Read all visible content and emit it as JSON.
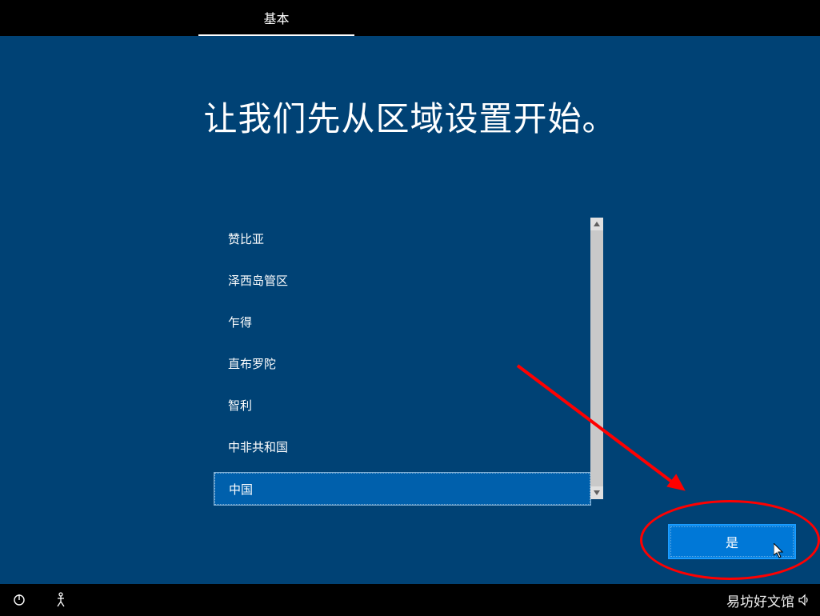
{
  "header": {
    "tab_label": "基本"
  },
  "heading": "让我们先从区域设置开始。",
  "regions": {
    "items": [
      {
        "label": "赞比亚",
        "selected": false
      },
      {
        "label": "泽西岛管区",
        "selected": false
      },
      {
        "label": "乍得",
        "selected": false
      },
      {
        "label": "直布罗陀",
        "selected": false
      },
      {
        "label": "智利",
        "selected": false
      },
      {
        "label": "中非共和国",
        "selected": false
      },
      {
        "label": "中国",
        "selected": true
      }
    ]
  },
  "buttons": {
    "confirm": "是"
  },
  "watermark": "易坊好文馆",
  "icons": {
    "power": "power-icon",
    "accessibility": "accessibility-icon",
    "speaker": "speaker-icon"
  },
  "annotation": {
    "ellipse_color": "#ff0000",
    "arrow_color": "#ff0000"
  }
}
